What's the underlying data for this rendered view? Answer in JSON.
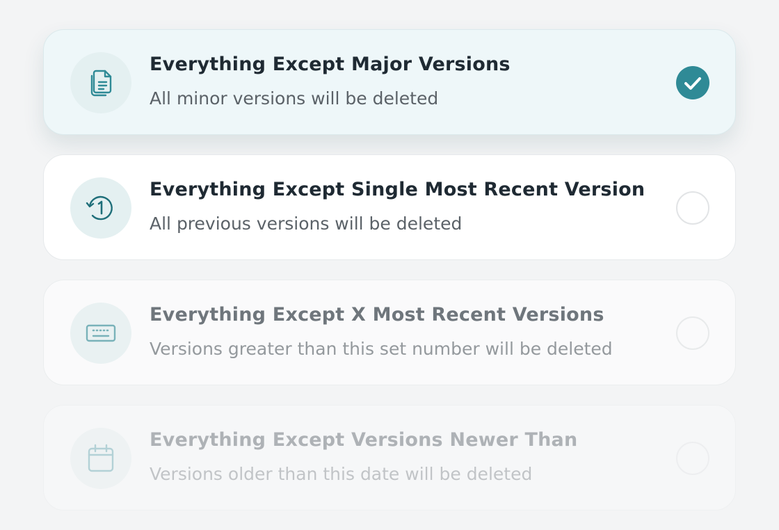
{
  "colors": {
    "accent": "#2f8a96",
    "background": "#f3f4f5",
    "selected_card": "#eef7f9",
    "icon_bg": "#e4f0f1"
  },
  "options": [
    {
      "title": "Everything Except Major Versions",
      "description": "All minor versions will be deleted",
      "icon": "documents-icon",
      "selected": true
    },
    {
      "title": "Everything Except Single Most Recent Version",
      "description": "All previous versions will be deleted",
      "icon": "history-one-icon",
      "selected": false
    },
    {
      "title": "Everything Except X Most Recent Versions",
      "description": "Versions greater than this set number will be deleted",
      "icon": "keyboard-icon",
      "selected": false
    },
    {
      "title": "Everything Except Versions Newer Than",
      "description": "Versions older than this date will be deleted",
      "icon": "calendar-icon",
      "selected": false
    }
  ]
}
